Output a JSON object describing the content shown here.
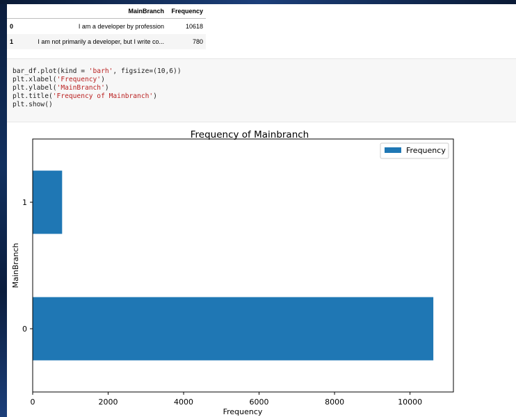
{
  "dataframe": {
    "columns": [
      "MainBranch",
      "Frequency"
    ],
    "rows": [
      {
        "index": "0",
        "main_branch": "I am a developer by profession",
        "frequency": "10618"
      },
      {
        "index": "1",
        "main_branch": "I am not primarily a developer, but I write co...",
        "frequency": "780"
      }
    ]
  },
  "code_lines": [
    "bar_df.plot(kind = 'barh', figsize=(10,6))",
    "plt.xlabel('Frequency')",
    "plt.ylabel('MainBranch')",
    "plt.title('Frequency of Mainbranch')",
    "plt.show()"
  ],
  "chart_data": {
    "type": "bar",
    "orientation": "horizontal",
    "title": "Frequency of Mainbranch",
    "xlabel": "Frequency",
    "ylabel": "MainBranch",
    "categories": [
      "0",
      "1"
    ],
    "series": [
      {
        "name": "Frequency",
        "values": [
          10618,
          780
        ],
        "color": "#1f77b4"
      }
    ],
    "xlim": [
      0,
      11150
    ],
    "xticks": [
      0,
      2000,
      4000,
      6000,
      8000,
      10000
    ],
    "legend_position": "top-right",
    "grid": false
  },
  "colors": {
    "bar": "#1f77b4",
    "page_background": "#0a1a35"
  }
}
